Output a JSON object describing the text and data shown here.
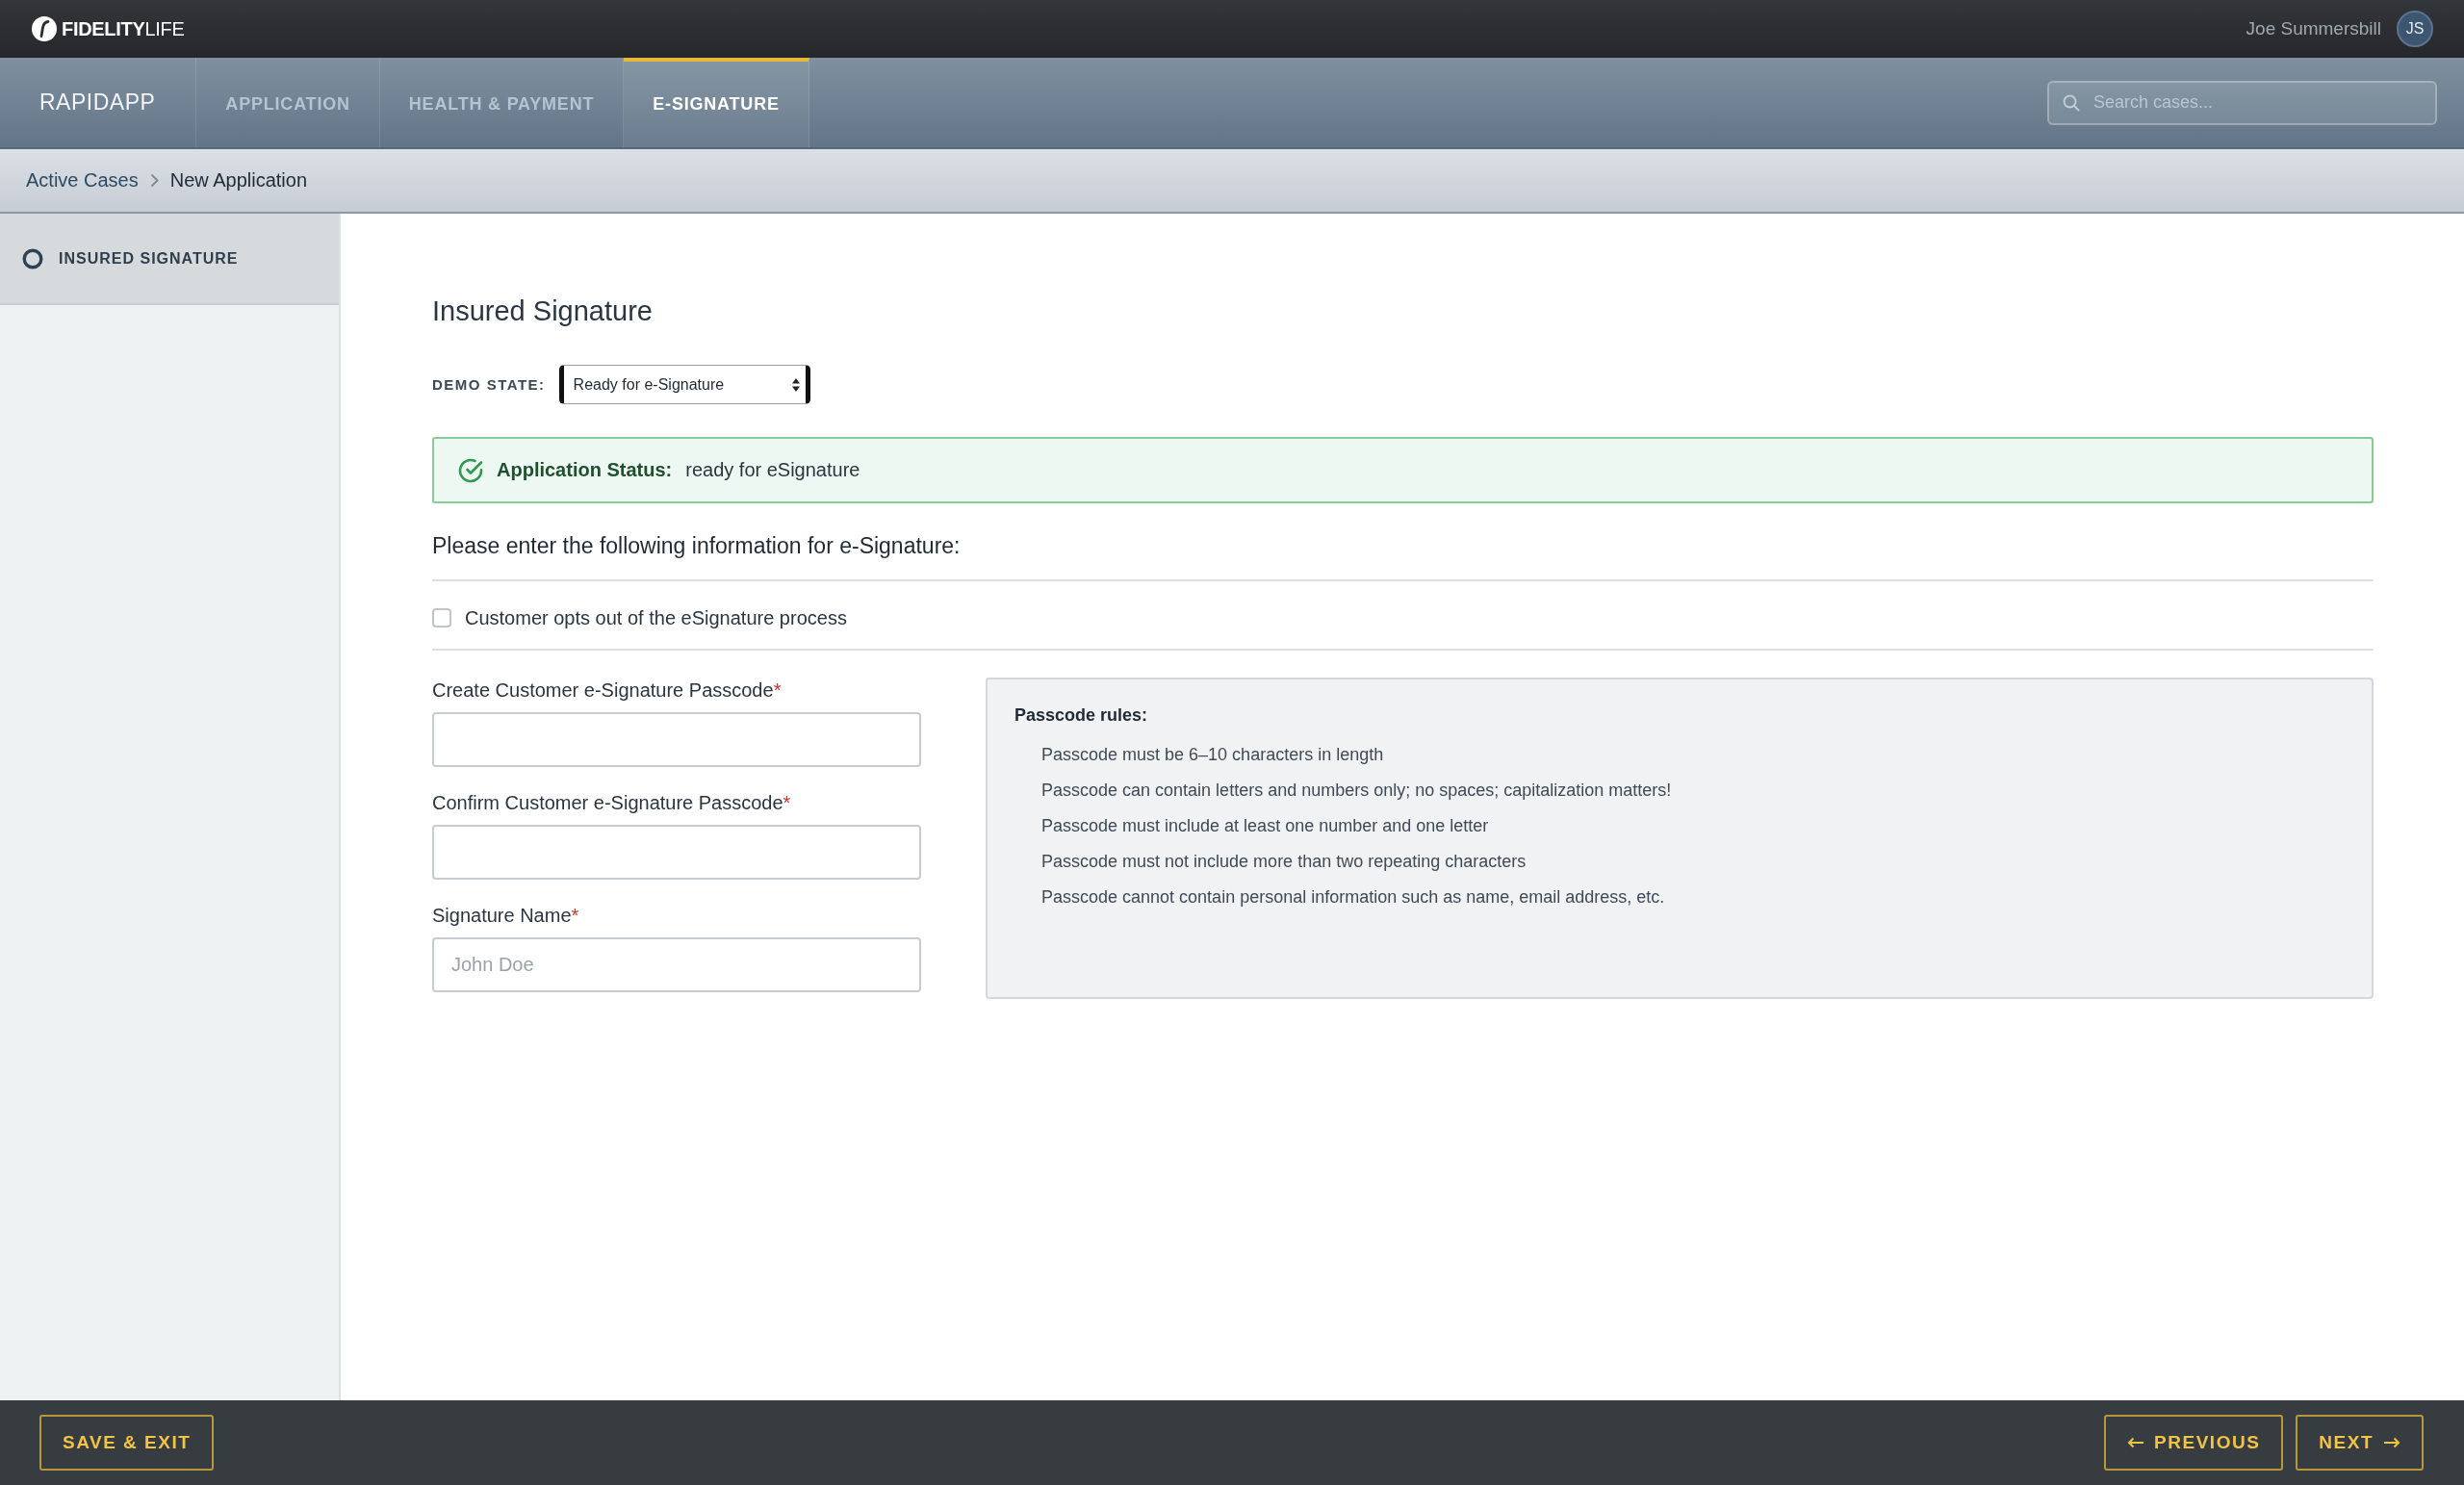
{
  "top_bar": {
    "logo_text": "**FIDELITY**LIFE",
    "user": {
      "name": "Joe Summersbill",
      "initials": "JS"
    }
  },
  "nav": {
    "app_name": "RAPIDAPP",
    "tabs": [
      {
        "label": "APPLICATION",
        "selected": false
      },
      {
        "label": "HEALTH & PAYMENT",
        "selected": false
      },
      {
        "label": "E-SIGNATURE",
        "selected": true
      }
    ],
    "search": {
      "placeholder": "Search cases..."
    }
  },
  "breadcrumb": [
    {
      "label": "Active Cases",
      "kind": "link"
    },
    {
      "label": "New Application",
      "kind": "current"
    }
  ],
  "sidebar": {
    "items": [
      {
        "label": "INSURED SIGNATURE",
        "selected": true
      }
    ]
  },
  "main": {
    "title": "Insured Signature",
    "demo_state": {
      "label": "DEMO STATE:",
      "value": "Ready for e-Signature"
    },
    "status": {
      "label": "Application Status:",
      "value": "ready for eSignature"
    },
    "heading": "Please enter the following information for e-Signature:",
    "opt_out": {
      "label": "Customer opts out of the eSignature process",
      "checked": false
    },
    "fields": [
      {
        "label": "Create Customer e-Signature Passcode",
        "required_mark": "*"
      },
      {
        "label": "Confirm Customer e-Signature Passcode",
        "required_mark": "*"
      },
      {
        "label": "Signature Name",
        "required_mark": "*",
        "placeholder": "John Doe"
      }
    ],
    "rules": {
      "title": "Passcode rules:",
      "items": [
        "Passcode must be 6–10 characters in length",
        "Passcode can contain letters and numbers only; no spaces; capitalization matters!",
        "Passcode must include at least one number and one letter",
        "Passcode must not include more than two repeating characters",
        "Passcode cannot contain personal information such as name, email address, etc."
      ]
    }
  },
  "footer": {
    "buttons": [
      {
        "label": "SAVE & EXIT",
        "kind": "save"
      },
      {
        "label": "PREVIOUS",
        "kind": "previous"
      },
      {
        "label": "NEXT",
        "kind": "next"
      }
    ]
  }
}
